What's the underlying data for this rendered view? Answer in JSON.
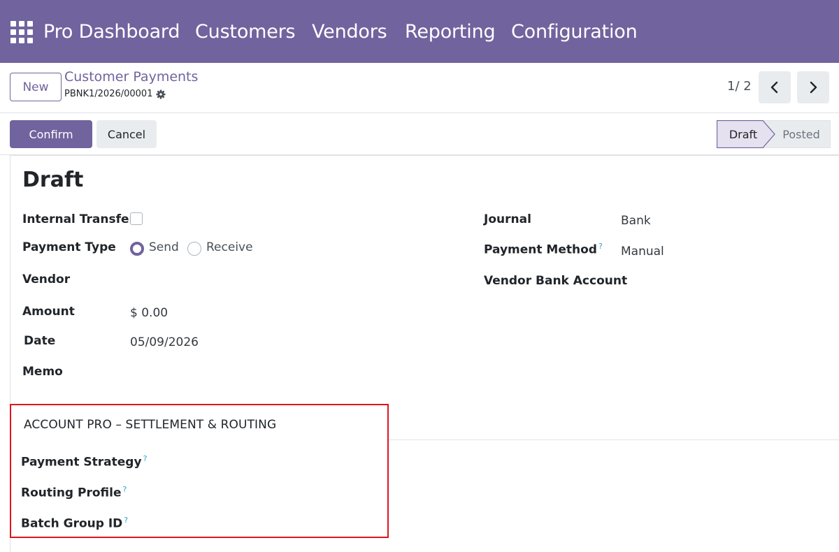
{
  "navbar": {
    "apps_icon": "grid-icon",
    "items": [
      "Pro Dashboard",
      "Customers",
      "Vendors",
      "Reporting",
      "Configuration"
    ]
  },
  "control_panel": {
    "new_label": "New",
    "breadcrumb": "Customer Payments",
    "record_ref": "PBNK1/2026/00001",
    "gear_icon": "gear-icon",
    "pager": "1/ 2",
    "prev_icon": "chevron-left-icon",
    "next_icon": "chevron-right-icon"
  },
  "statusbar": {
    "confirm_label": "Confirm",
    "cancel_label": "Cancel",
    "stages": [
      "Draft",
      "Posted"
    ],
    "active_stage": "Draft"
  },
  "form": {
    "state_title": "Draft",
    "left": {
      "internal_transfer_label": "Internal Transfer",
      "internal_transfer_checked": false,
      "payment_type_label": "Payment Type",
      "payment_type_options": [
        "Send",
        "Receive"
      ],
      "payment_type_selected": "Send",
      "vendor_label": "Vendor",
      "amount_label": "Amount",
      "amount_value": "$ 0.00",
      "date_label": "Date",
      "date_value": "05/09/2026",
      "memo_label": "Memo"
    },
    "right": {
      "journal_label": "Journal",
      "journal_value": "Bank",
      "payment_method_label": "Payment Method",
      "payment_method_value": "Manual",
      "vendor_bank_account_label": "Vendor Bank Account"
    },
    "help_marker": "?",
    "section": {
      "title": "ACCOUNT PRO – SETTLEMENT & ROUTING",
      "payment_strategy_label": "Payment Strategy",
      "routing_profile_label": "Routing Profile",
      "batch_group_id_label": "Batch Group ID"
    }
  },
  "colors": {
    "brand": "#71639e",
    "highlight": "#e0141e",
    "help": "#2f9fc9"
  }
}
